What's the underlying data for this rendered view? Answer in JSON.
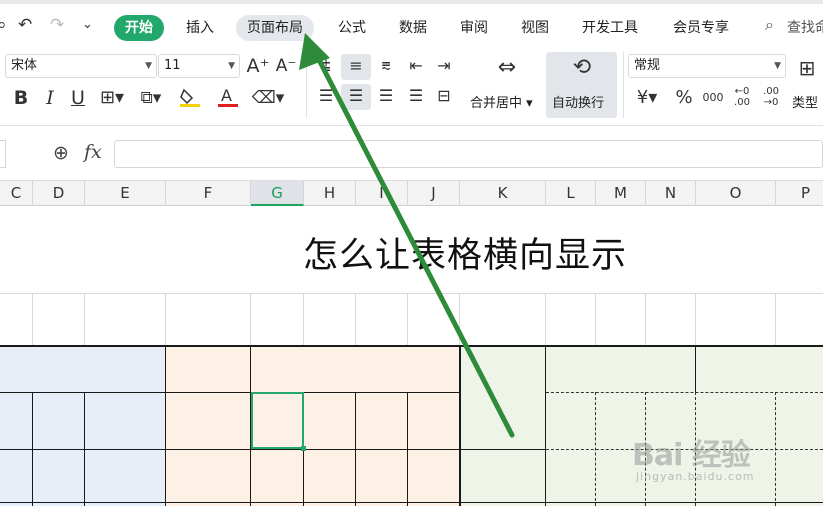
{
  "quick_access": {
    "more_label": "⌄"
  },
  "tabs": [
    {
      "label": "开始",
      "state": "active"
    },
    {
      "label": "插入",
      "state": "normal"
    },
    {
      "label": "页面布局",
      "state": "hover"
    },
    {
      "label": "公式",
      "state": "normal"
    },
    {
      "label": "数据",
      "state": "normal"
    },
    {
      "label": "审阅",
      "state": "normal"
    },
    {
      "label": "视图",
      "state": "normal"
    },
    {
      "label": "开发工具",
      "state": "normal"
    },
    {
      "label": "会员专享",
      "state": "normal"
    }
  ],
  "search": {
    "label": "查找命"
  },
  "ribbon": {
    "font_name": "宋体",
    "font_size": "11",
    "increase_font": "A⁺",
    "decrease_font": "A⁻",
    "bold": "B",
    "italic": "I",
    "underline": "U",
    "merge_center": "合并居中",
    "wrap_text": "自动换行",
    "number_format": "常规",
    "currency": "¥",
    "percent": "%",
    "thousands": "000",
    "decimal_inc": "←0 .00",
    "decimal_dec": ".00 →0",
    "type_convert": "类型"
  },
  "formula_bar": {
    "fx_label": "fx",
    "value": ""
  },
  "columns": [
    "C",
    "D",
    "E",
    "F",
    "G",
    "H",
    "I",
    "J",
    "K",
    "L",
    "M",
    "N",
    "O",
    "P"
  ],
  "selected_column": "G",
  "sheet": {
    "title": "怎么让表格横向显示"
  },
  "colors": {
    "accent": "#22a86a",
    "arrow": "#2e8b3a",
    "block_blue": "#e8eef7",
    "block_orange": "#fdf0e4",
    "block_green": "#eef4e8"
  },
  "watermark": {
    "text": "Bai 经验",
    "url": "jingyan.baidu.com"
  }
}
